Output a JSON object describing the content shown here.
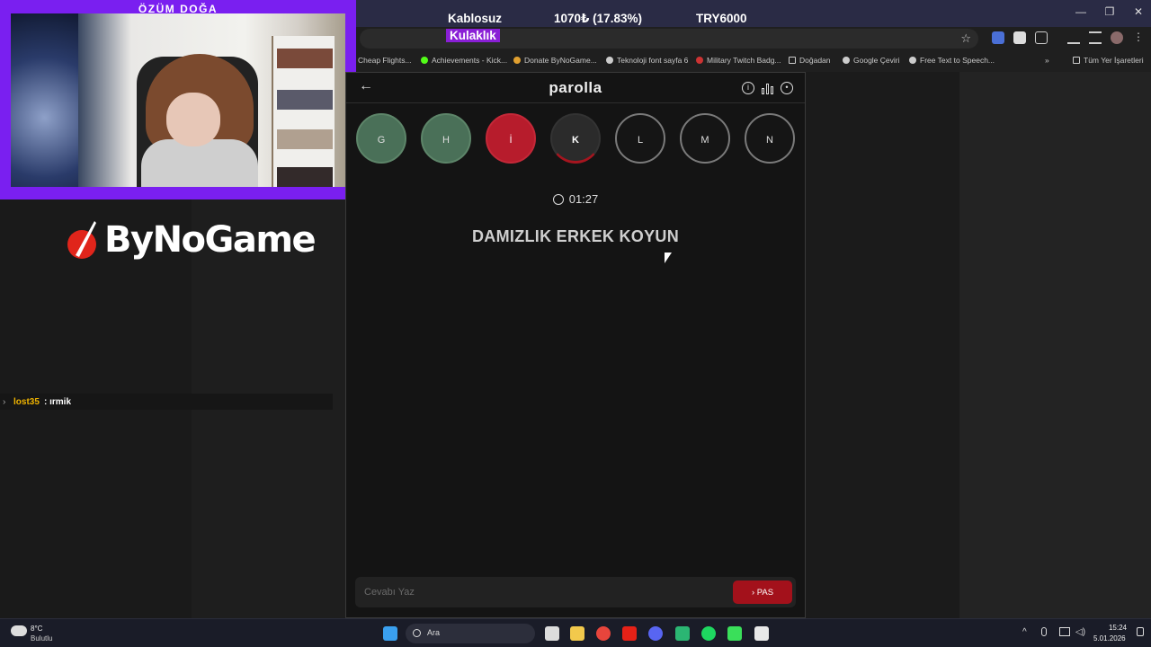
{
  "stream_overlay": {
    "webcam_title": "ÖZÜM DOĞA",
    "item_line1": "Kablosuz",
    "item_line2": "Kulaklık",
    "price": "1070₺ (17.83%)",
    "goal": "TRY6000",
    "logo_text": "ByNoGame",
    "chat": {
      "user": "lost35",
      "separator": " : ",
      "message": "ırmik"
    }
  },
  "bookmarks": [
    "Cheap Flights...",
    "Achievements - Kick...",
    "Donate ByNoGame...",
    "Teknoloji font sayfa 6",
    "Military Twitch Badg...",
    "Doğadan",
    "Google Çeviri",
    "Free Text to Speech...",
    "»",
    "Tüm Yer İşaretleri"
  ],
  "game": {
    "title": "parolla",
    "letters": [
      {
        "char": "G",
        "state": "correct"
      },
      {
        "char": "H",
        "state": "correct"
      },
      {
        "char": "İ",
        "state": "wrong"
      },
      {
        "char": "K",
        "state": "current"
      },
      {
        "char": "L",
        "state": "pending"
      },
      {
        "char": "M",
        "state": "pending"
      },
      {
        "char": "N",
        "state": "pending"
      }
    ],
    "timer": "01:27",
    "question": "DAMIZLIK ERKEK KOYUN",
    "answer_placeholder": "Cevabı Yaz",
    "pass_label": "PAS",
    "colors": {
      "correct": "#4a7058",
      "wrong": "#b71c2c",
      "accent": "#a3111b"
    }
  },
  "taskbar": {
    "weather_temp": "8°C",
    "weather_desc": "Bulutlu",
    "search_label": "Ara",
    "time": "15:24",
    "date": "5.01.2026"
  }
}
